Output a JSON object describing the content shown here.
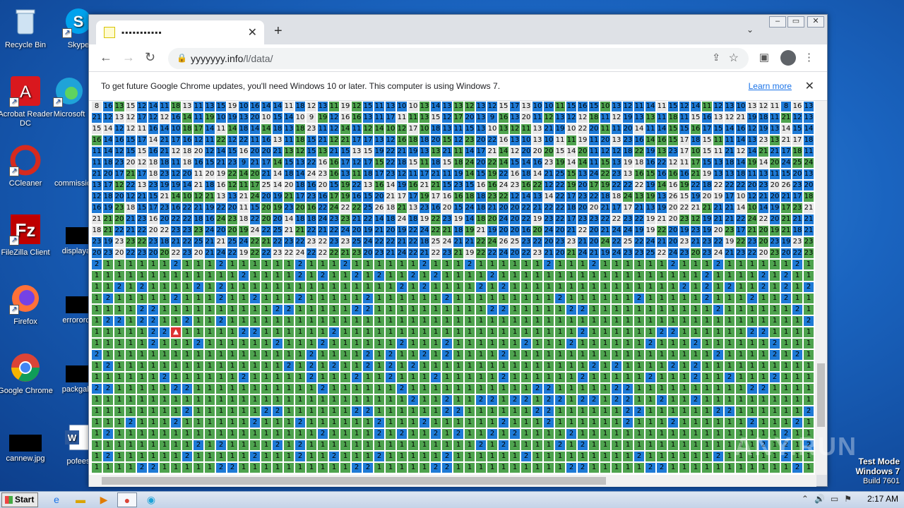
{
  "desktop": {
    "icons": [
      {
        "label": "Recycle Bin"
      },
      {
        "label": "Skype"
      },
      {
        "label": "Acrobat Reader DC"
      },
      {
        "label": "Microsoft"
      },
      {
        "label": "CCleaner"
      },
      {
        "label": "commissio"
      },
      {
        "label": "FileZilla Client"
      },
      {
        "label": "displayau"
      },
      {
        "label": "Firefox"
      },
      {
        "label": "errororde"
      },
      {
        "label": "Google Chrome"
      },
      {
        "label": "packgalle"
      },
      {
        "label": "cannew.jpg"
      },
      {
        "label": "pofees"
      }
    ]
  },
  "browser": {
    "tab_title": "▪▪▪▪▪▪▪▪▪▪▪",
    "new_tab": "+",
    "url_host": "yyyyyyy.info",
    "url_path": "/l/data/",
    "infobar_message": "To get future Google Chrome updates, you'll need Windows 10 or later. This computer is using Windows 7.",
    "learn_more": "Learn more"
  },
  "game": {
    "top_rows": [
      "8,16,13,15,12,14,11,18,13,11,13,15,19,10,16,14,14,11,18,12,13,11,19,12,15,11,13,10,10,13,14,13,13,12,13,12,15,17,13,10,10,11,15,16,15,10,13,12,11,14,11,15,12,14,11,12,13,10,13,12,11",
      "21,12,13,12,17,12,12,16,14,11,19,10,19,13,20,10,15,14,10,9,19,12,16,16,13,11,17,11,11,13,15,12,17,20,13,9,16,13,20,11,12,13,12,12,18,11,12,19,13,13,11,18,11,15,16,13,12,21,19,18,11",
      "15,14,12,12,11,16,14,10,18,17,14,11,14,18,14,14,18,13,18,23,11,12,14,11,12,14,10,12,17,10,18,13,11,15,13,10,13,12,11,13,21,19,10,22,20,11,11,20,14,11,14,15,15,16,17,15,14,16,12,19,13,14",
      "16,14,16,15,17,14,21,17,16,12,11,22,12,22,11,16,13,11,18,15,21,12,21,17,17,13,12,16,18,18,20,15,12,23,20,22,16,13,10,13,10,11,11,19,11,20,13,23,16,14,16,15,17,18,15,11,11,14,13,23,13,21,17,18",
      "11,14,12,15,15,16,21,12,18,20,12,14,15,16,20,20,21,13,12,15,13,21,15,13,15,19,22,21,19,13,13,21,11,14,17,21,14,12,20,20,20,15,14,20,11,12,12,18,22,19,13,23,17,10,15,11,21,12,14,21,21,17,18",
      "11,18,23,20,12,18,18,11,18,16,15,21,23,9,21,17,14,15,13,22,16,16,17,12,17,15,22,18,15,11,18,15,18,24,20,22,14,15,14,16,23,19,14,14,11,15,13,19,18,16,22,12,11,17,15,13,18,14,19,14,20,24,25,24,18,19",
      "21,20,17,21,17,18,23,12,20,11,20,19,22,14,20,21,14,18,14,24,23,16,13,11,18,17,23,12,11,17,21,11,19,14,15,19,22,16,18,14,21,25,15,13,24,22,23,13,16,15,16,16,16,21,19,13,13,18,11,13,11,15,20,13",
      "13,17,12,22,13,23,19,19,14,21,18,16,12,11,17,25,14,20,18,16,20,15,19,22,13,16,14,19,16,21,21,15,23,15,16,16,24,23,16,22,12,22,19,20,17,19,22,22,22,19,14,16,19,22,18,22,22,22,20,23,20,26,23,20,15",
      "12,18,20,12,21,15,21,14,10,12,21,13,13,21,24,20,19,21,17,23,16,17,19,16,15,20,21,17,17,19,17,16,16,18,18,23,22,12,14,13,14,22,17,23,22,18,18,24,13,19,13,26,15,19,20,19,17,10,12,21,20,21,17,18",
      "16,19,23,18,15,17,23,16,22,21,19,22,20,11,15,20,19,23,20,16,22,24,22,22,25,26,18,21,13,23,16,20,15,24,18,21,20,20,22,21,22,22,18,20,20,21,17,17,21,13,19,20,22,21,21,21,21,14,10,14,19,17,23,21",
      "21,21,20,21,23,16,20,22,22,18,16,24,23,18,22,20,20,14,18,18,24,23,23,21,22,14,18,24,18,19,22,23,19,14,18,20,24,20,22,19,23,22,17,23,23,22,22,23,22,19,21,20,23,12,19,21,21,22,24,22,20,21",
      "18,21,22,21,22,20,22,23,23,23,24,20,20,19,24,22,25,21,21,22,21,22,24,20,19,21,20,19,22,24,22,21,18,19,21,19,20,20,16,20,24,20,21,22,20,21,24,24,19,19,22,20,19,23,19,20,23,17,21,20,19,21",
      "23,19,23,23,22,23,18,21,22,25,21,21,25,24,22,21,22,23,22,23,22,23,23,25,24,22,22,21,22,18,25,24,21,21,22,24,26,25,23,22,20,23,23,21,20,24,22,25,22,24,21,20,23,21,23,22,19,22,23,20",
      "20,23,20,22,23,20,20,22,23,20,21,24,22,19,22,22,23,22,24,22,22,22,21,23,20,23,21,24,22,21,22,23,21,19,22,22,24,20,22,23,21,20,21,24,21,19,24,23,23,25,22,24,23,20,23,24,21,23,22"
    ],
    "mine_symbol": "▲"
  },
  "taskbar": {
    "start_label": "Start",
    "clock": "2:17 AM"
  },
  "overlay": {
    "watermark": "ANY.RUN",
    "test_mode_line1": "Test Mode",
    "test_mode_line2": "Windows 7",
    "test_mode_line3": "Build 7601"
  }
}
